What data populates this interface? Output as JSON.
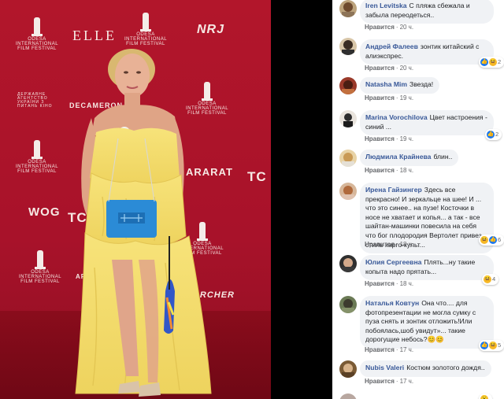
{
  "photo": {
    "wall_logos": {
      "festival_line1": "ODESA",
      "festival_line2": "INTERNATIONAL",
      "festival_line3": "FILM FESTIVAL",
      "elle": "ELLE",
      "nrj": "NRJ",
      "decameron": "DECAMERON",
      "ararat": "ARARAT",
      "woG": "WOG",
      "tc": "TC",
      "karcher": "KARCHER",
      "agency": "ДЕРЖАВНЕ АГЕНТСТВО УКРАЇНИ З ПИТАНЬ КІНО"
    }
  },
  "comments": [
    {
      "name": "Iren Levitska",
      "text": "С пляжа сбежала и забыла переодеться..",
      "like_label": "Нравится",
      "time": "20 ч.",
      "reaction_count": ""
    },
    {
      "name": "Андрей Фалеев",
      "text": "зонтик китайский с алиэкспрес.",
      "like_label": "Нравится",
      "time": "20 ч.",
      "reaction_count": "2"
    },
    {
      "name": "Natasha Mim",
      "text": "Звезда!",
      "like_label": "Нравится",
      "time": "19 ч.",
      "reaction_count": ""
    },
    {
      "name": "Marina Vorochilova",
      "text": "Цвет настроения - синий ...",
      "like_label": "Нравится",
      "time": "19 ч.",
      "reaction_count": "2"
    },
    {
      "name": "Людмила Крайнева",
      "text": "блин..",
      "like_label": "Нравится",
      "time": "18 ч.",
      "reaction_count": ""
    },
    {
      "name": "Ирена Гайзингер",
      "text": "Здесь все прекрасно! И зеркальце на шее! И ... что это синее.. на пузе! Косточки в носе не хватает и копья... а так - все шайтан-машинки повесила на себя что бог плодородия Вертолет привез... стиль карго-культ...",
      "like_label": "Нравится",
      "time": "18 ч.",
      "reaction_count": "6"
    },
    {
      "name": "Юлия Сергеевна",
      "text": "Плять...ну такие копыта надо прятать...",
      "like_label": "Нравится",
      "time": "18 ч.",
      "reaction_count": "4"
    },
    {
      "name": "Наталья Ковтун",
      "text": "Она что.... для фотопрезентации не могла сумку с пуза снять и зонтик отложить!Или побоялась,шоб увидут»... такие дорогущие небось?😊😊",
      "like_label": "Нравится",
      "time": "17 ч.",
      "reaction_count": "5"
    },
    {
      "name": "Nubis Valeri",
      "text": "Костюм золотого дождя..",
      "like_label": "Нравится",
      "time": "17 ч.",
      "reaction_count": ""
    }
  ],
  "separator": "·"
}
